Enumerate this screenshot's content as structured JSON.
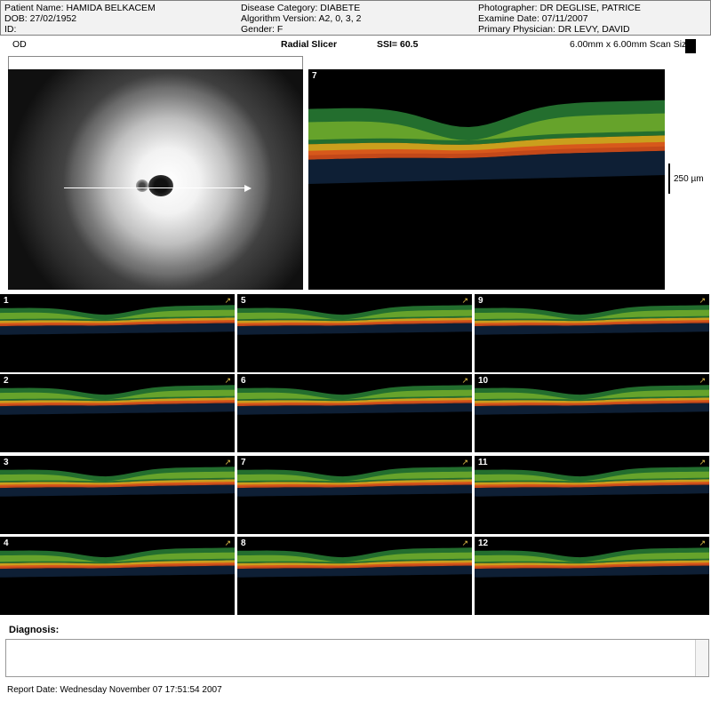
{
  "header": {
    "col1": [
      "Patient Name: HAMIDA  BELKACEM",
      "DOB: 27/02/1952",
      "ID:"
    ],
    "col2": [
      "Disease Category: DIABETE",
      "Algorithm Version: A2, 0, 3, 2",
      "Gender: F"
    ],
    "col3": [
      "Photographer: DR DEGLISE, PATRICE",
      "Examine Date: 07/11/2007",
      "Primary Physician: DR LEVY, DAVID"
    ]
  },
  "scan": {
    "eye": "OD",
    "mode": "Radial Slicer",
    "ssi": "SSI= 60.5",
    "scan_size": "6.00mm x 6.00mm Scan Size"
  },
  "main_scan_number": "7",
  "scale_label": "250 µm",
  "thumbnails": [
    "1",
    "5",
    "9",
    "2",
    "6",
    "10",
    "3",
    "7",
    "11",
    "4",
    "8",
    "12"
  ],
  "diagnosis": {
    "label": "Diagnosis:",
    "value": ""
  },
  "report_date": "Report Date: Wednesday November 07 17:51:54 2007"
}
